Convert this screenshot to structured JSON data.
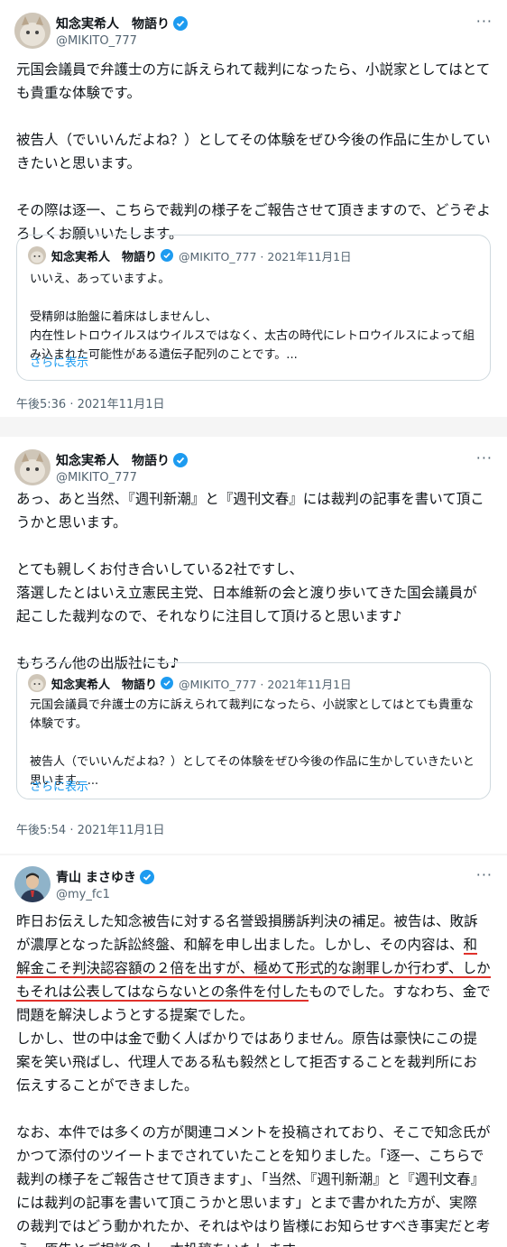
{
  "tweet1": {
    "name": "知念実希人　物語り",
    "handle": "@MIKITO_777",
    "more": "···",
    "text": "元国会議員で弁護士の方に訴えられて裁判になったら、小説家としてはとても貴重な体験です。\n\n被告人（でいいんだよね？）としてその体験をぜひ今後の作品に生かしていきたいと思います。\n\nその際は逐一、こちらで裁判の様子をご報告させて頂きますので、どうぞよろしくお願いいたします。",
    "quote": {
      "name": "知念実希人　物語り",
      "handle_date": "@MIKITO_777 · 2021年11月1日",
      "text": "いいえ、あっていますよ。\n\n受精卵は胎盤に着床はしませんし、\n内在性レトロウイルスはウイルスではなく、太古の時代にレトロウイルスによって組み込まれた可能性がある遺伝子配列のことです。...",
      "show_more": "さらに表示"
    },
    "timestamp": "午後5:36 · 2021年11月1日"
  },
  "tweet2": {
    "name": "知念実希人　物語り",
    "handle": "@MIKITO_777",
    "more": "···",
    "text": "あっ、あと当然、『週刊新潮』と『週刊文春』には裁判の記事を書いて頂こうかと思います。\n\nとても親しくお付き合いしている2社ですし、\n落選したとはいえ立憲民主党、日本維新の会と渡り歩いてきた国会議員が起こした裁判なので、それなりに注目して頂けると思います♪\n\nもちろん他の出版社にも♪",
    "quote": {
      "name": "知念実希人　物語り",
      "handle_date": "@MIKITO_777 · 2021年11月1日",
      "text": "元国会議員で弁護士の方に訴えられて裁判になったら、小説家としてはとても貴重な体験です。\n\n被告人（でいいんだよね？）としてその体験をぜひ今後の作品に生かしていきたいと思います。...",
      "show_more": "さらに表示"
    },
    "timestamp": "午後5:54 · 2021年11月1日"
  },
  "tweet3": {
    "name": "青山 まさゆき",
    "handle": "@my_fc1",
    "more": "···",
    "text_a": "昨日お伝えした知念被告に対する名誉毀損勝訴判決の補足。被告は、敗訴が濃厚となった訴訟終盤、和解を申し出ました。しかし、その内容は、",
    "text_underlined": "和解金こそ判決認容額の２倍を出すが、極めて形式的な謝罪しか行わず、しかもそれは公表してはならないとの条件を付した",
    "text_b": "ものでした。すなわち、金で問題を解決しようとする提案でした。",
    "text_c": "しかし、世の中は金で動く人ばかりではありません。原告は豪快にこの提案を笑い飛ばし、代理人である私も毅然として拒否することを裁判所にお伝えすることができました。\n\nなお、本件では多くの方が関連コメントを投稿されており、そこで知念氏がかつて添付のツイートまでされていたことを知りました。「逐一、こちらで裁判の様子をご報告させて頂きます」、「当然、『週刊新潮』と『週刊文春』には裁判の記事を書いて頂こうかと思います」とまで書かれた方が、実際の裁判ではどう動かれたか、それはやはり皆様にお知らせすべき事実だと考え、原告とご相談の上、本投稿をいたします。"
  },
  "colors": {
    "verified": "#1d9bf0",
    "underline": "#e0312b",
    "muted": "#536471"
  }
}
